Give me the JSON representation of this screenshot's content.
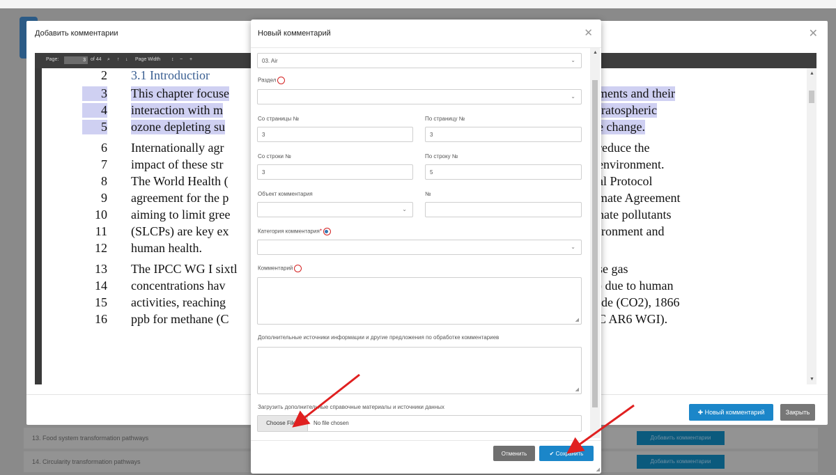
{
  "background": {
    "rows": [
      {
        "label": "13. Food system transformation pathways",
        "button": "Добавить комментарии"
      },
      {
        "label": "14. Circularity transformation pathways",
        "button": "Добавить комментарии"
      }
    ]
  },
  "outer_dialog": {
    "title": "Добавить комментарии",
    "new_comment_label": "Новый комментарий",
    "close_label": "Закрыть",
    "pdf_toolbar": {
      "page_label": "Page:",
      "page_value": "3",
      "page_total": "of 44",
      "zoom_label": "Page Width"
    },
    "pdf_lines": [
      {
        "n": "2",
        "text": "3.1   Introductior",
        "highlight": false,
        "heading": true
      },
      {
        "n": "3",
        "text": "This chapter focuse",
        "right": "ments and their",
        "highlight": true
      },
      {
        "n": "4",
        "text": "interaction with m",
        "right": "tratospheric",
        "highlight": true
      },
      {
        "n": "5",
        "text": "ozone depleting su",
        "right": "e change.",
        "highlight": true
      },
      {
        "n": "6",
        "text": "Internationally agr",
        "right": "reduce the",
        "highlight": false
      },
      {
        "n": "7",
        "text": "impact of these str",
        "right": "environment.",
        "highlight": false
      },
      {
        "n": "8",
        "text": "The World Health (",
        "right": "al Protocol",
        "highlight": false
      },
      {
        "n": "9",
        "text": "agreement for the p",
        "right": "mate Agreement",
        "highlight": false
      },
      {
        "n": "10",
        "text": "aiming to limit gree",
        "right": "nate pollutants",
        "highlight": false
      },
      {
        "n": "11",
        "text": "(SLCPs) are key ex",
        "right": "ironment and",
        "highlight": false
      },
      {
        "n": "12",
        "text": "human health.",
        "highlight": false
      },
      {
        "n": "13",
        "text": "The IPCC WG I sixtl",
        "right": "se gas",
        "highlight": false
      },
      {
        "n": "14",
        "text": "concentrations hav",
        "right": ") due to human",
        "highlight": false
      },
      {
        "n": "15",
        "text": "activities, reaching",
        "right": "ide (CO2), 1866",
        "highlight": false
      },
      {
        "n": "16",
        "text": "ppb for methane (C",
        "right": "C AR6 WGI).",
        "highlight": false
      }
    ]
  },
  "modal": {
    "title": "Новый комментарий",
    "chapter_value": "03. Air",
    "section_label": "Раздел",
    "from_page_label": "Со страницы №",
    "from_page_value": "3",
    "to_page_label": "По страницу №",
    "to_page_value": "3",
    "from_line_label": "Со строки №",
    "from_line_value": "3",
    "to_line_label": "По строку №",
    "to_line_value": "5",
    "object_label": "Объект комментария",
    "number_label": "№",
    "category_label": "Категория комментария",
    "comment_label": "Комментарий",
    "extra_sources_label": "Дополнительные источники информации и другие предложения по обработке комментариев",
    "upload_label": "Загрузить дополнительные справочные материалы и источники данных",
    "choose_files": "Choose Files",
    "no_file": "No file chosen",
    "cancel": "Отменить",
    "save": "Сохранить",
    "required_mark": "*"
  },
  "colors": {
    "primary": "#1b86c9",
    "highlight": "#cfd0f2",
    "arrow": "#e02020",
    "required_circle": "#d42222"
  }
}
